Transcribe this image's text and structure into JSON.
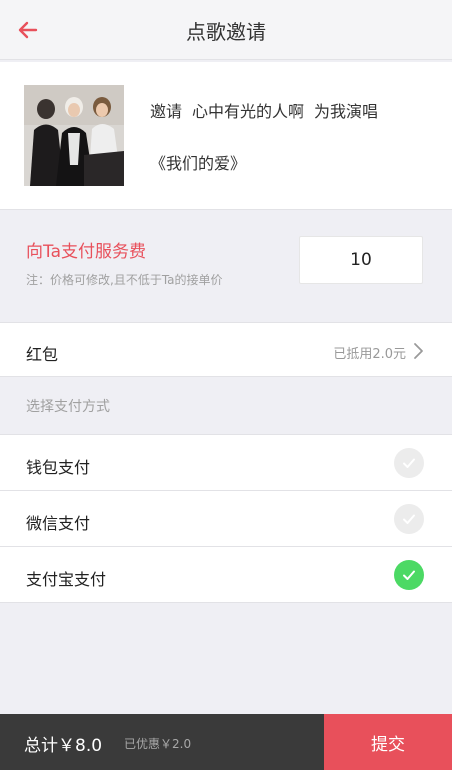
{
  "header": {
    "title": "点歌邀请"
  },
  "song": {
    "invite_prefix": "邀请",
    "inviter_name": "心中有光的人啊",
    "invite_suffix": "为我演唱",
    "song_title": "《我们的爱》"
  },
  "fee": {
    "title": "向Ta支付服务费",
    "note": "注：价格可修改,且不低于Ta的接单价",
    "value": "10"
  },
  "red_packet": {
    "label": "红包",
    "value": "已抵用2.0元"
  },
  "payment": {
    "section_label": "选择支付方式",
    "methods": [
      {
        "label": "钱包支付",
        "selected": false
      },
      {
        "label": "微信支付",
        "selected": false
      },
      {
        "label": "支付宝支付",
        "selected": true
      }
    ]
  },
  "footer": {
    "total": "总计￥8.0",
    "discount": "已优惠￥2.0",
    "submit_label": "提交"
  },
  "colors": {
    "accent": "#e8505b",
    "check_on": "#4cd964",
    "check_off": "#ececec",
    "footer_bg": "#3a3a3a"
  }
}
